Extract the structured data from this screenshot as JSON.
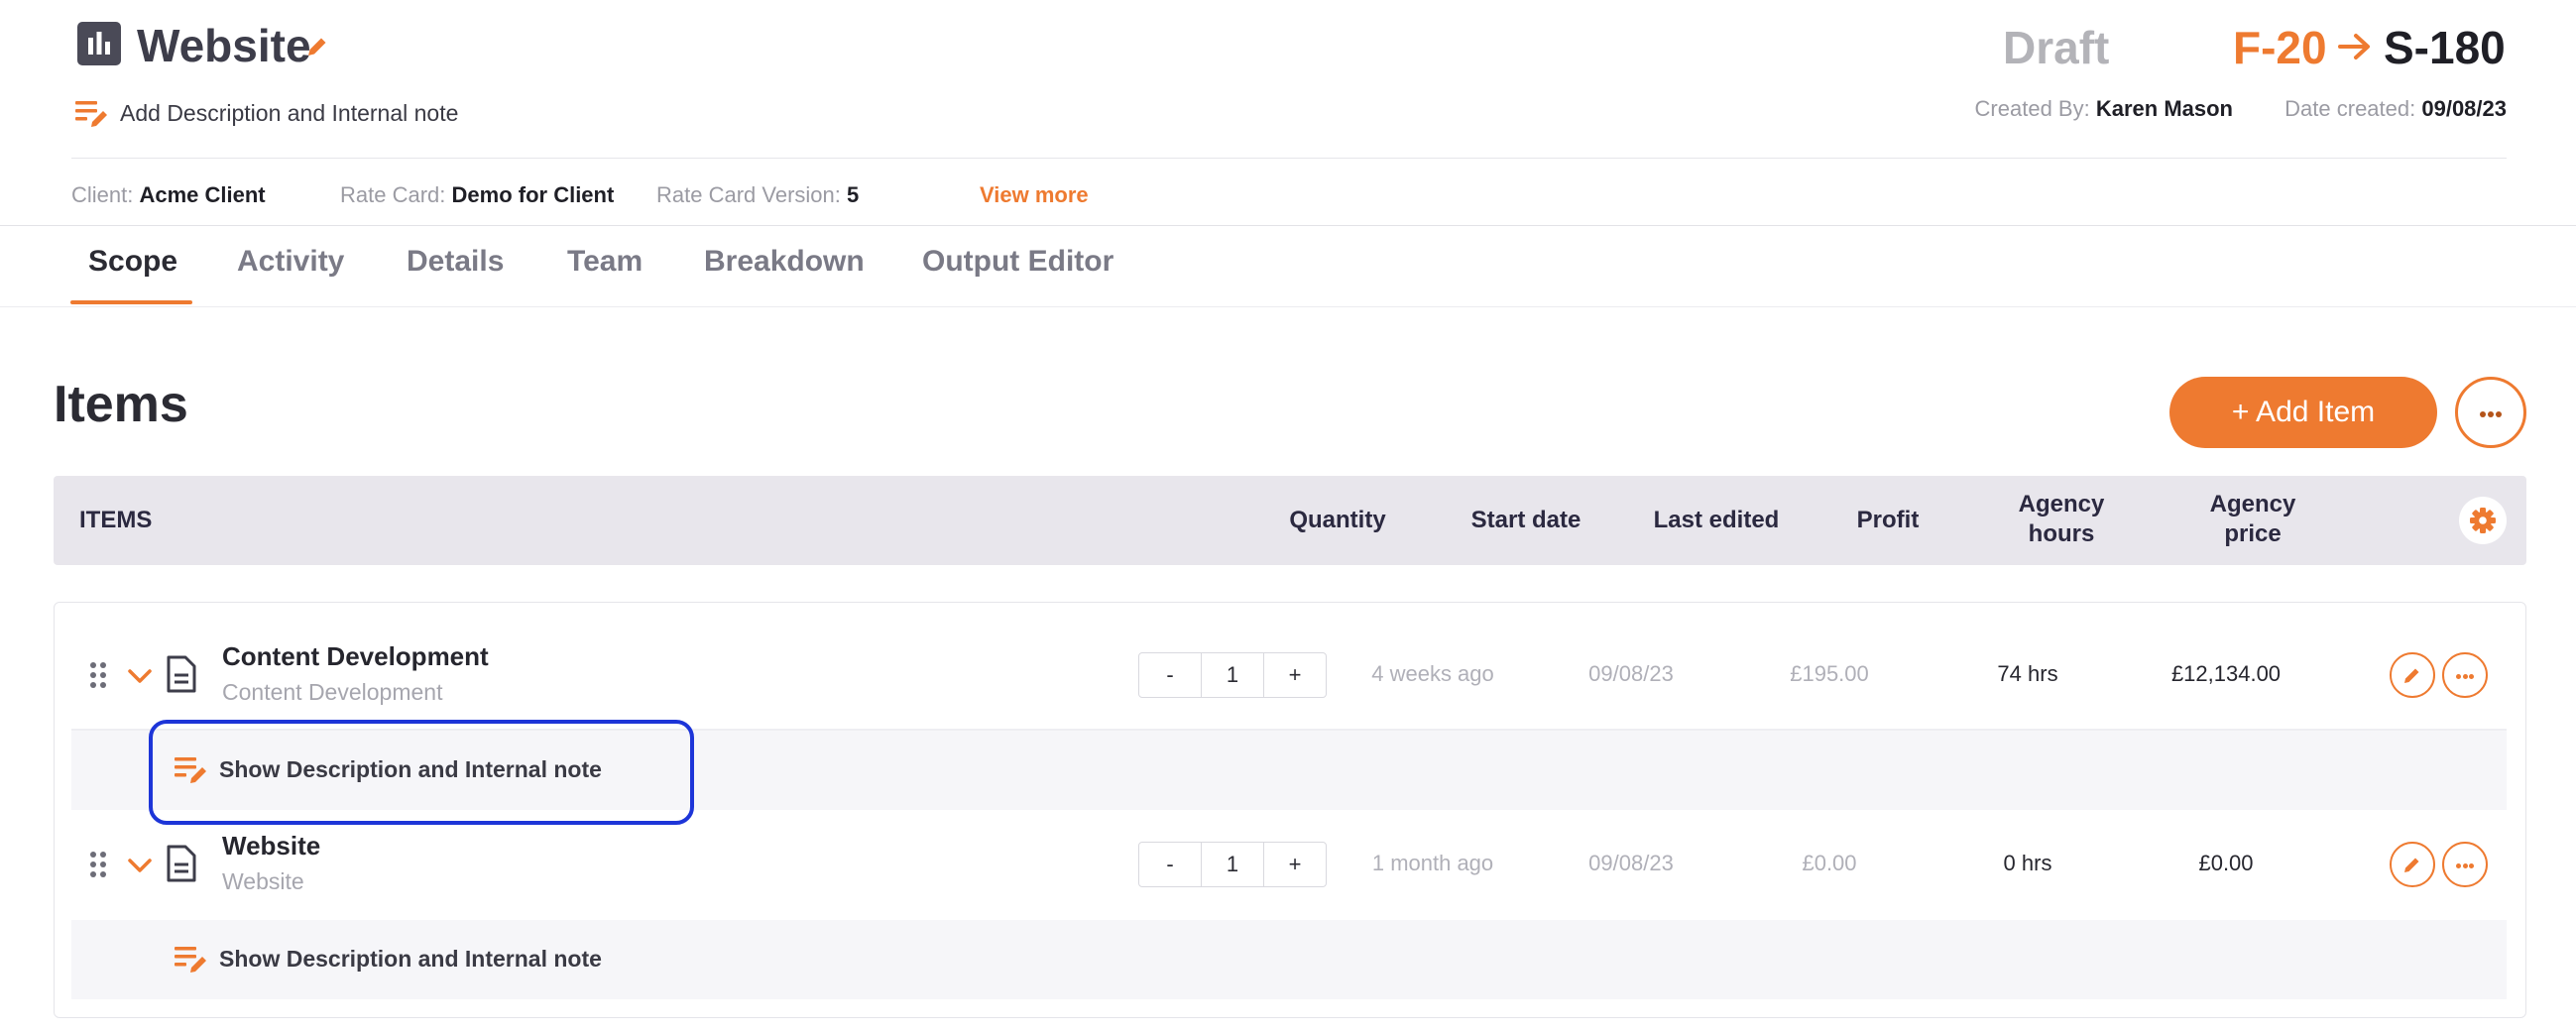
{
  "header": {
    "title": "Website",
    "description_link": "Add Description and Internal note",
    "status": "Draft",
    "id_from": "F-20",
    "id_to": "S-180",
    "created_by_label": "Created By:",
    "created_by": "Karen Mason",
    "date_created_label": "Date created:",
    "date_created": "09/08/23"
  },
  "meta": {
    "client_label": "Client:",
    "client": "Acme Client",
    "rate_card_label": "Rate Card:",
    "rate_card": "Demo for Client",
    "rate_card_version_label": "Rate Card Version:",
    "rate_card_version": "5",
    "view_more": "View more"
  },
  "tabs": [
    {
      "label": "Scope",
      "active": true
    },
    {
      "label": "Activity"
    },
    {
      "label": "Details"
    },
    {
      "label": "Team"
    },
    {
      "label": "Breakdown"
    },
    {
      "label": "Output Editor"
    }
  ],
  "items_section": {
    "heading": "Items",
    "add_item_label": "+ Add Item",
    "columns": {
      "items": "ITEMS",
      "quantity": "Quantity",
      "start_date": "Start date",
      "last_edited": "Last edited",
      "profit": "Profit",
      "agency_hours_1": "Agency",
      "agency_hours_2": "hours",
      "agency_price_1": "Agency",
      "agency_price_2": "price"
    },
    "rows": [
      {
        "title": "Content Development",
        "subtitle": "Content Development",
        "minus": "-",
        "quantity": "1",
        "plus": "+",
        "start_date": "4 weeks ago",
        "last_edited": "09/08/23",
        "profit": "£195.00",
        "agency_hours": "74 hrs",
        "agency_price": "£12,134.00",
        "note_link": "Show Description and Internal note"
      },
      {
        "title": "Website",
        "subtitle": "Website",
        "minus": "-",
        "quantity": "1",
        "plus": "+",
        "start_date": "1 month ago",
        "last_edited": "09/08/23",
        "profit": "£0.00",
        "agency_hours": "0 hrs",
        "agency_price": "£0.00",
        "note_link": "Show Description and Internal note"
      }
    ]
  },
  "colors": {
    "accent": "#ee7a30",
    "focus": "#1d35d8",
    "header_bg": "#e8e6ec"
  },
  "icons": [
    "bar-chart-icon",
    "pencil-icon",
    "note-edit-icon",
    "arrow-right-icon",
    "more-icon",
    "gear-icon",
    "drag-handle-icon",
    "chevron-down-icon",
    "document-icon"
  ]
}
